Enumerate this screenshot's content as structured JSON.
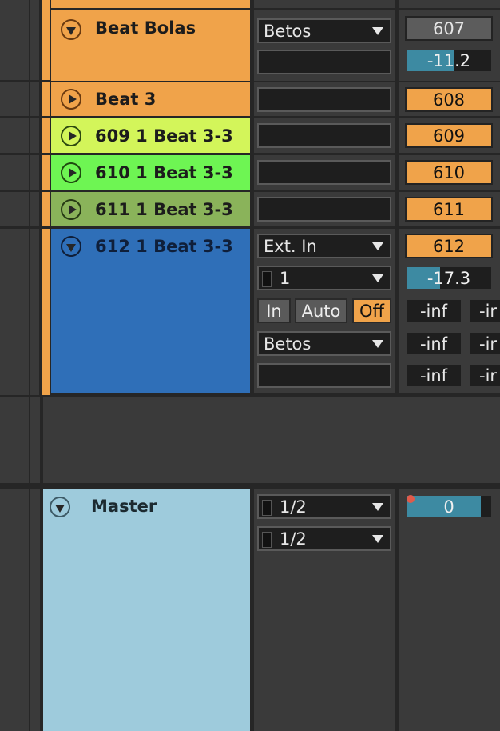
{
  "tracks": [
    {
      "name": "Beat Bolas",
      "color": "#f0a34a",
      "text_color": "#1c1c1c",
      "state": "expanded",
      "input_type": "Betos",
      "input_channel": "",
      "number": "607",
      "number_state": "unselected",
      "volume": "-11.2",
      "volume_fraction": 0.57
    },
    {
      "name": "Beat 3",
      "color": "#f0a34a",
      "text_color": "#1c1c1c",
      "state": "collapsed",
      "input_type": "",
      "number": "608"
    },
    {
      "name": "609 1 Beat 3-3",
      "color": "#d3f55a",
      "text_color": "#1c1c1c",
      "state": "collapsed",
      "input_type": "",
      "number": "609"
    },
    {
      "name": "610 1 Beat 3-3",
      "color": "#6ef553",
      "text_color": "#1c1c1c",
      "state": "collapsed",
      "input_type": "",
      "number": "610"
    },
    {
      "name": "611 1 Beat 3-3",
      "color": "#8ab35a",
      "text_color": "#1c1c1c",
      "state": "collapsed",
      "input_type": "",
      "number": "611"
    },
    {
      "name": "612 1 Beat 3-3",
      "color": "#2f6fb8",
      "text_color": "#0f1f3a",
      "state": "expanded",
      "input_type": "Ext. In",
      "input_channel": "1",
      "number": "612",
      "volume": "-17.3",
      "volume_fraction": 0.4,
      "monitor": {
        "in": "In",
        "auto": "Auto",
        "off": "Off",
        "active": "Off"
      },
      "output_type": "Betos",
      "output_channel": "",
      "sends": [
        "-inf",
        "-inf",
        "-inf"
      ],
      "sends_cut": [
        "-ir",
        "-ir",
        "-ir"
      ]
    }
  ],
  "master": {
    "name": "Master",
    "color": "#9ecbdc",
    "input_type": "1/2",
    "output_type": "1/2",
    "volume": "0",
    "volume_fraction": 0.88,
    "clip_indicator_color": "#e05a4a"
  },
  "icons": {
    "collapsed": "fold-right-icon",
    "expanded": "fold-down-icon",
    "dropdown": "chevron-down-icon"
  }
}
